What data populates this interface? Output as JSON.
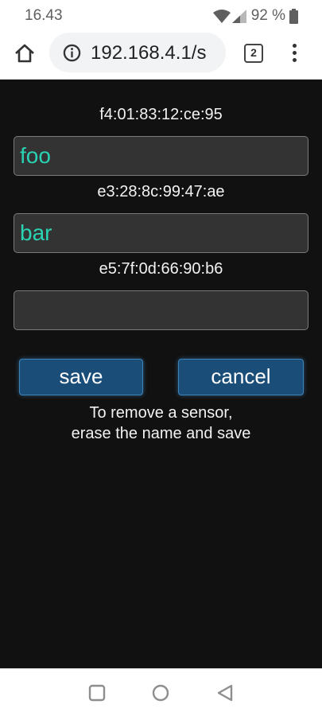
{
  "status_bar": {
    "time": "16.43",
    "battery_percent": "92 %",
    "icons": [
      "wifi-icon",
      "signal-icon",
      "battery-icon"
    ]
  },
  "browser": {
    "url": "192.168.4.1/s",
    "tab_count": "2",
    "icons": [
      "home-icon",
      "info-icon",
      "tabs-icon",
      "more-vert-icon"
    ]
  },
  "page": {
    "sensors": [
      {
        "mac": "f4:01:83:12:ce:95",
        "name": "foo"
      },
      {
        "mac": "e3:28:8c:99:47:ae",
        "name": "bar"
      },
      {
        "mac": "e5:7f:0d:66:90:b6",
        "name": ""
      }
    ],
    "save_label": "save",
    "cancel_label": "cancel",
    "help_line1": "To remove a sensor,",
    "help_line2": "erase the name and save"
  },
  "nav_bar": {
    "icons": [
      "recents-icon",
      "home-circle-icon",
      "back-icon"
    ]
  },
  "colors": {
    "page_background": "#111111",
    "input_background": "#333333",
    "input_text": "#2ad3b4",
    "button_background": "#1a4e78",
    "text": "#f2f2f2"
  }
}
